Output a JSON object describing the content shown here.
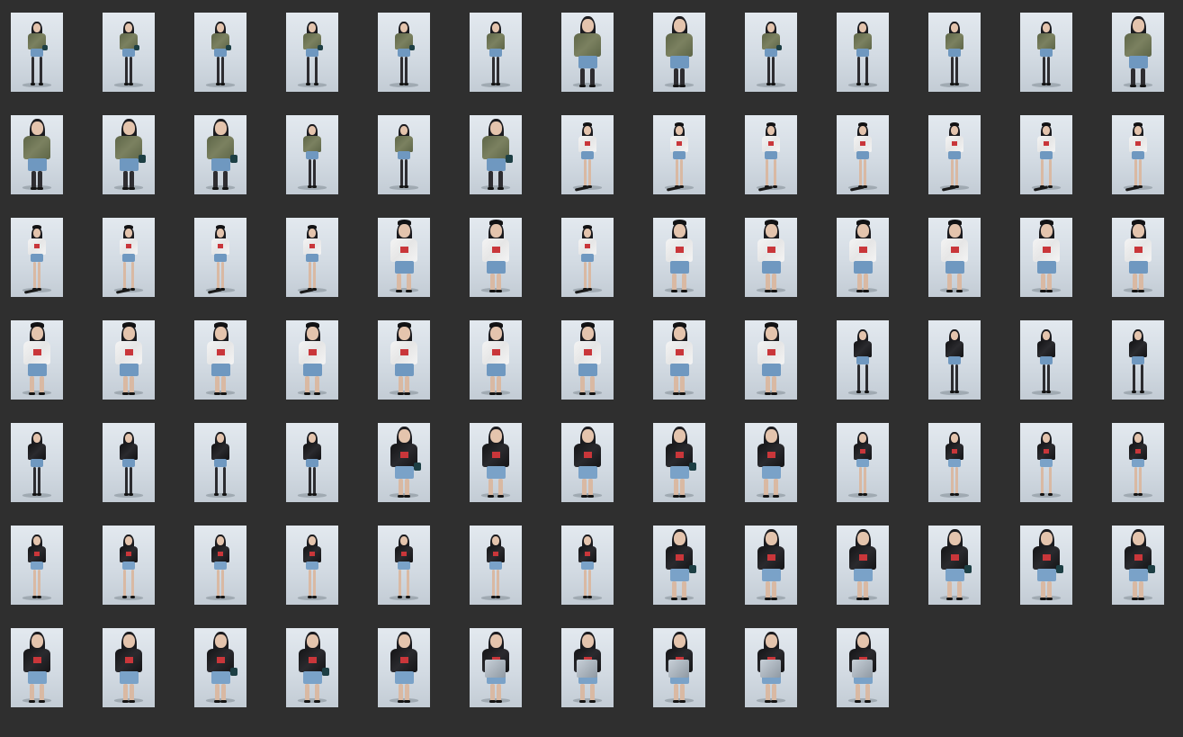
{
  "sheet": {
    "title": "",
    "background": "#2f2f2f",
    "photo_background": "#dde3ea",
    "thumbnail_count": 88
  },
  "outfits": {
    "camo": {
      "top": "#5d6547",
      "top_shade": "#7b8160",
      "legs": "#2e2d31",
      "skirt": "#6f98c0",
      "cap": false,
      "accent": false
    },
    "white": {
      "top": "#f4f4f4",
      "top_shade": "#e6e6e6",
      "legs": "#d9b9a3",
      "skirt": "#6f98c0",
      "cap": true,
      "accent": true
    },
    "black": {
      "top": "#121214",
      "top_shade": "#2a2a2e",
      "legs": "#2c2c30",
      "skirt": "#6f98c0",
      "cap": false,
      "accent": false
    },
    "blacktee": {
      "top": "#141416",
      "top_shade": "#2a2a2e",
      "legs": "#d9b9a3",
      "skirt": "#7aa2c8",
      "cap": false,
      "accent": true
    }
  },
  "rows": [
    {
      "photos": [
        {
          "outfit": "camo",
          "pose": "full",
          "prop": "bag"
        },
        {
          "outfit": "camo",
          "pose": "full",
          "prop": "bag"
        },
        {
          "outfit": "camo",
          "pose": "full",
          "prop": "bag"
        },
        {
          "outfit": "camo",
          "pose": "full",
          "prop": "bag"
        },
        {
          "outfit": "camo",
          "pose": "full",
          "prop": "bag"
        },
        {
          "outfit": "camo",
          "pose": "full",
          "prop": "none"
        },
        {
          "outfit": "camo",
          "pose": "close",
          "prop": "none"
        },
        {
          "outfit": "camo",
          "pose": "close",
          "prop": "none"
        },
        {
          "outfit": "camo",
          "pose": "full",
          "prop": "bag"
        },
        {
          "outfit": "camo",
          "pose": "full",
          "prop": "none"
        },
        {
          "outfit": "camo",
          "pose": "full",
          "prop": "none"
        },
        {
          "outfit": "camo",
          "pose": "full",
          "prop": "none"
        },
        {
          "outfit": "camo",
          "pose": "close",
          "prop": "none"
        }
      ]
    },
    {
      "photos": [
        {
          "outfit": "camo",
          "pose": "close",
          "prop": "none"
        },
        {
          "outfit": "camo",
          "pose": "close",
          "prop": "bag"
        },
        {
          "outfit": "camo",
          "pose": "close",
          "prop": "bag"
        },
        {
          "outfit": "camo",
          "pose": "full",
          "prop": "none"
        },
        {
          "outfit": "camo",
          "pose": "full",
          "prop": "none"
        },
        {
          "outfit": "camo",
          "pose": "close",
          "prop": "bag"
        },
        {
          "outfit": "white",
          "pose": "full",
          "prop": "skateboard"
        },
        {
          "outfit": "white",
          "pose": "full",
          "prop": "skateboard"
        },
        {
          "outfit": "white",
          "pose": "full",
          "prop": "skateboard"
        },
        {
          "outfit": "white",
          "pose": "full",
          "prop": "skateboard"
        },
        {
          "outfit": "white",
          "pose": "full",
          "prop": "skateboard"
        },
        {
          "outfit": "white",
          "pose": "full",
          "prop": "skateboard"
        },
        {
          "outfit": "white",
          "pose": "full",
          "prop": "skateboard"
        }
      ]
    },
    {
      "photos": [
        {
          "outfit": "white",
          "pose": "full",
          "prop": "skateboard"
        },
        {
          "outfit": "white",
          "pose": "full",
          "prop": "skateboard"
        },
        {
          "outfit": "white",
          "pose": "full",
          "prop": "skateboard"
        },
        {
          "outfit": "white",
          "pose": "full",
          "prop": "skateboard"
        },
        {
          "outfit": "white",
          "pose": "close",
          "prop": "none"
        },
        {
          "outfit": "white",
          "pose": "close",
          "prop": "none"
        },
        {
          "outfit": "white",
          "pose": "full",
          "prop": "skateboard"
        },
        {
          "outfit": "white",
          "pose": "close",
          "prop": "none"
        },
        {
          "outfit": "white",
          "pose": "close",
          "prop": "none"
        },
        {
          "outfit": "white",
          "pose": "close",
          "prop": "none"
        },
        {
          "outfit": "white",
          "pose": "close",
          "prop": "none"
        },
        {
          "outfit": "white",
          "pose": "close",
          "prop": "none"
        },
        {
          "outfit": "white",
          "pose": "close",
          "prop": "none"
        }
      ]
    },
    {
      "photos": [
        {
          "outfit": "white",
          "pose": "close",
          "prop": "none"
        },
        {
          "outfit": "white",
          "pose": "close",
          "prop": "none"
        },
        {
          "outfit": "white",
          "pose": "close",
          "prop": "none"
        },
        {
          "outfit": "white",
          "pose": "close",
          "prop": "none"
        },
        {
          "outfit": "white",
          "pose": "close",
          "prop": "none"
        },
        {
          "outfit": "white",
          "pose": "close",
          "prop": "none"
        },
        {
          "outfit": "white",
          "pose": "close",
          "prop": "none"
        },
        {
          "outfit": "white",
          "pose": "close",
          "prop": "none"
        },
        {
          "outfit": "white",
          "pose": "close",
          "prop": "none"
        },
        {
          "outfit": "black",
          "pose": "full",
          "prop": "none"
        },
        {
          "outfit": "black",
          "pose": "full",
          "prop": "none"
        },
        {
          "outfit": "black",
          "pose": "full",
          "prop": "none"
        },
        {
          "outfit": "black",
          "pose": "full",
          "prop": "none"
        }
      ]
    },
    {
      "photos": [
        {
          "outfit": "black",
          "pose": "full",
          "prop": "none"
        },
        {
          "outfit": "black",
          "pose": "full",
          "prop": "none"
        },
        {
          "outfit": "black",
          "pose": "full",
          "prop": "none"
        },
        {
          "outfit": "black",
          "pose": "full",
          "prop": "none"
        },
        {
          "outfit": "blacktee",
          "pose": "close",
          "prop": "bag"
        },
        {
          "outfit": "blacktee",
          "pose": "close",
          "prop": "none"
        },
        {
          "outfit": "blacktee",
          "pose": "close",
          "prop": "none"
        },
        {
          "outfit": "blacktee",
          "pose": "close",
          "prop": "bag"
        },
        {
          "outfit": "blacktee",
          "pose": "close",
          "prop": "none"
        },
        {
          "outfit": "blacktee",
          "pose": "full",
          "prop": "none"
        },
        {
          "outfit": "blacktee",
          "pose": "full",
          "prop": "none"
        },
        {
          "outfit": "blacktee",
          "pose": "full",
          "prop": "none"
        },
        {
          "outfit": "blacktee",
          "pose": "full",
          "prop": "none"
        }
      ]
    },
    {
      "photos": [
        {
          "outfit": "blacktee",
          "pose": "full",
          "prop": "none"
        },
        {
          "outfit": "blacktee",
          "pose": "full",
          "prop": "none"
        },
        {
          "outfit": "blacktee",
          "pose": "full",
          "prop": "none"
        },
        {
          "outfit": "blacktee",
          "pose": "full",
          "prop": "none"
        },
        {
          "outfit": "blacktee",
          "pose": "full",
          "prop": "none"
        },
        {
          "outfit": "blacktee",
          "pose": "full",
          "prop": "none"
        },
        {
          "outfit": "blacktee",
          "pose": "full",
          "prop": "none"
        },
        {
          "outfit": "blacktee",
          "pose": "close",
          "prop": "bag"
        },
        {
          "outfit": "blacktee",
          "pose": "close",
          "prop": "none"
        },
        {
          "outfit": "blacktee",
          "pose": "close",
          "prop": "none"
        },
        {
          "outfit": "blacktee",
          "pose": "close",
          "prop": "bag"
        },
        {
          "outfit": "blacktee",
          "pose": "close",
          "prop": "bag"
        },
        {
          "outfit": "blacktee",
          "pose": "close",
          "prop": "bag"
        }
      ]
    },
    {
      "photos": [
        {
          "outfit": "blacktee",
          "pose": "close",
          "prop": "none"
        },
        {
          "outfit": "blacktee",
          "pose": "close",
          "prop": "none"
        },
        {
          "outfit": "blacktee",
          "pose": "close",
          "prop": "bag"
        },
        {
          "outfit": "blacktee",
          "pose": "close",
          "prop": "bag"
        },
        {
          "outfit": "blacktee",
          "pose": "close",
          "prop": "none"
        },
        {
          "outfit": "blacktee",
          "pose": "close",
          "prop": "silverbag"
        },
        {
          "outfit": "blacktee",
          "pose": "close",
          "prop": "silverbag"
        },
        {
          "outfit": "blacktee",
          "pose": "close",
          "prop": "silverbag"
        },
        {
          "outfit": "blacktee",
          "pose": "close",
          "prop": "silverbag"
        },
        {
          "outfit": "blacktee",
          "pose": "close",
          "prop": "silverbag"
        }
      ]
    }
  ]
}
